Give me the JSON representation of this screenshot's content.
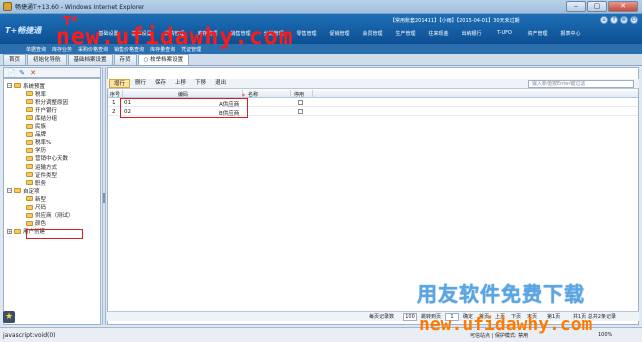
{
  "window": {
    "title": "畅捷通T+13.60 - Windows Internet Explorer",
    "min": "–",
    "max": "▢",
    "close": "✕"
  },
  "banner": {
    "logo": "T+畅捷通",
    "company": "【常用账套201411】【小雨】【2015-04-01】30天未过期",
    "menu": [
      "基础设置",
      "基础设置",
      "采购管理",
      "库存管理",
      "销售管理",
      "分销管理",
      "零售管理",
      "促销管理",
      "会员管理",
      "生产管理",
      "往来现金",
      "出纳银行",
      "T-UFO",
      "资产管理",
      "报表中心"
    ]
  },
  "quickstrip": [
    "单据查询",
    "库存业务",
    "采购价格查询",
    "销售价格查询",
    "库存量查询",
    "凭证管理"
  ],
  "tabs": [
    "首页",
    "初始化导航",
    "基础档案设置",
    "存货",
    "○ 枚举档案设置"
  ],
  "tree": {
    "toolbar": [
      "📄",
      "✎",
      "✕"
    ],
    "nodes": [
      {
        "label": "系统预置",
        "level": 0,
        "toggle": "−"
      },
      {
        "label": "税率",
        "level": 1
      },
      {
        "label": "积分调整原因",
        "level": 1
      },
      {
        "label": "开户银行",
        "level": 1
      },
      {
        "label": "库结分组",
        "level": 1
      },
      {
        "label": "民族",
        "level": 1
      },
      {
        "label": "品牌",
        "level": 1
      },
      {
        "label": "税率%",
        "level": 1
      },
      {
        "label": "学历",
        "level": 1
      },
      {
        "label": "营销中心天数",
        "level": 1
      },
      {
        "label": "运输方式",
        "level": 1
      },
      {
        "label": "证件类型",
        "level": 1
      },
      {
        "label": "职务",
        "level": 1
      },
      {
        "label": "自定项",
        "level": 0,
        "toggle": "−"
      },
      {
        "label": "新型",
        "level": 1
      },
      {
        "label": "尺码",
        "level": 1
      },
      {
        "label": "供应商（测试）",
        "level": 1
      },
      {
        "label": "颜色",
        "level": 1
      },
      {
        "label": "用户创建",
        "level": 0,
        "toggle": "+"
      }
    ]
  },
  "actions": [
    "增行",
    "删行",
    "保存",
    "上移",
    "下移",
    "退出"
  ],
  "search": {
    "placeholder": "输入新值按Enter键过滤"
  },
  "grid": {
    "headers": [
      "序号",
      "编码",
      "名称",
      "停用"
    ],
    "rows": [
      {
        "seq": "1",
        "code": "01",
        "name": "A供应商"
      },
      {
        "seq": "2",
        "code": "02",
        "name": "B供应商"
      }
    ]
  },
  "pager": {
    "per_page_label": "每页记录数",
    "per_page": "100",
    "jump_label": "跳转到页",
    "jump_value": "1",
    "ok": "确定",
    "first": "首页",
    "prev": "上页",
    "next": "下页",
    "last": "末页",
    "current": "第1页",
    "total": "共1页 总共2条记录"
  },
  "status": {
    "url": "javascript:void(0)",
    "zone": "可信站点 | 保护模式: 禁用",
    "zoom": "100%"
  },
  "watermark": {
    "top": "new.ufidawhy.com",
    "top_mark": "T*",
    "bottom_cn": "用友软件免费下载",
    "bottom_url": "new.ufidawhy.com"
  }
}
